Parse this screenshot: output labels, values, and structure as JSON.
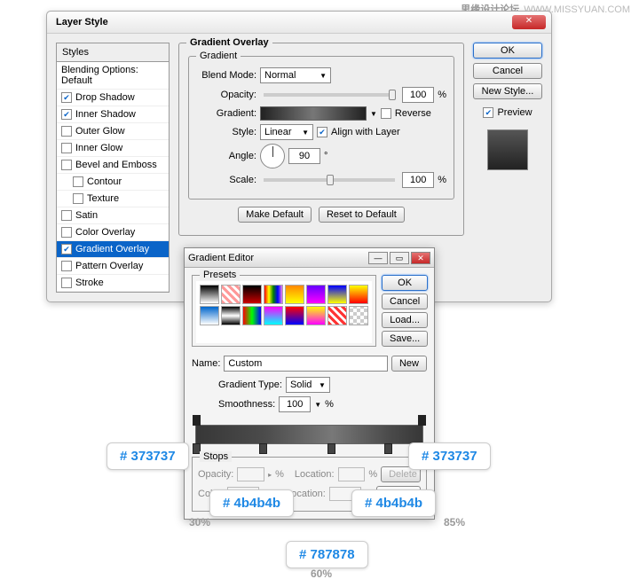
{
  "watermark": {
    "cn": "思缘设计论坛",
    "url": "WWW.MISSYUAN.COM"
  },
  "dialog": {
    "title": "Layer Style",
    "styles_header": "Styles",
    "blending_options": "Blending Options: Default",
    "items": [
      {
        "label": "Drop Shadow",
        "checked": true
      },
      {
        "label": "Inner Shadow",
        "checked": true
      },
      {
        "label": "Outer Glow",
        "checked": false
      },
      {
        "label": "Inner Glow",
        "checked": false
      },
      {
        "label": "Bevel and Emboss",
        "checked": false
      },
      {
        "label": "Contour",
        "checked": false,
        "indent": true
      },
      {
        "label": "Texture",
        "checked": false,
        "indent": true
      },
      {
        "label": "Satin",
        "checked": false
      },
      {
        "label": "Color Overlay",
        "checked": false
      },
      {
        "label": "Gradient Overlay",
        "checked": true,
        "selected": true
      },
      {
        "label": "Pattern Overlay",
        "checked": false
      },
      {
        "label": "Stroke",
        "checked": false
      }
    ],
    "panel": {
      "title": "Gradient Overlay",
      "sub": "Gradient",
      "blend_mode_label": "Blend Mode:",
      "blend_mode": "Normal",
      "opacity_label": "Opacity:",
      "opacity": "100",
      "pct": "%",
      "gradient_label": "Gradient:",
      "reverse": "Reverse",
      "style_label": "Style:",
      "style": "Linear",
      "align": "Align with Layer",
      "angle_label": "Angle:",
      "angle": "90",
      "deg": "°",
      "scale_label": "Scale:",
      "scale": "100",
      "make_default": "Make Default",
      "reset_default": "Reset to Default"
    },
    "right": {
      "ok": "OK",
      "cancel": "Cancel",
      "new_style": "New Style...",
      "preview": "Preview"
    }
  },
  "ge": {
    "title": "Gradient Editor",
    "presets_label": "Presets",
    "ok": "OK",
    "cancel": "Cancel",
    "load": "Load...",
    "save": "Save...",
    "name_label": "Name:",
    "name": "Custom",
    "new": "New",
    "gradient_type_label": "Gradient Type:",
    "gradient_type": "Solid",
    "smoothness_label": "Smoothness:",
    "smoothness": "100",
    "pct": "%",
    "stops_label": "Stops",
    "opacity_label": "Opacity:",
    "location_label": "Location:",
    "color_label": "Color:",
    "delete": "Delete"
  },
  "annotations": {
    "a1": "# 373737",
    "a2": "# 373737",
    "a3": "# 4b4b4b",
    "a4": "# 4b4b4b",
    "a5": "# 787878",
    "p1": "30%",
    "p2": "85%",
    "p3": "60%"
  },
  "chart_data": {
    "type": "table",
    "gradient_stops": [
      {
        "color": "#373737",
        "location_pct": 0
      },
      {
        "color": "#4b4b4b",
        "location_pct": 30
      },
      {
        "color": "#787878",
        "location_pct": 60
      },
      {
        "color": "#4b4b4b",
        "location_pct": 85
      },
      {
        "color": "#373737",
        "location_pct": 100
      }
    ]
  }
}
